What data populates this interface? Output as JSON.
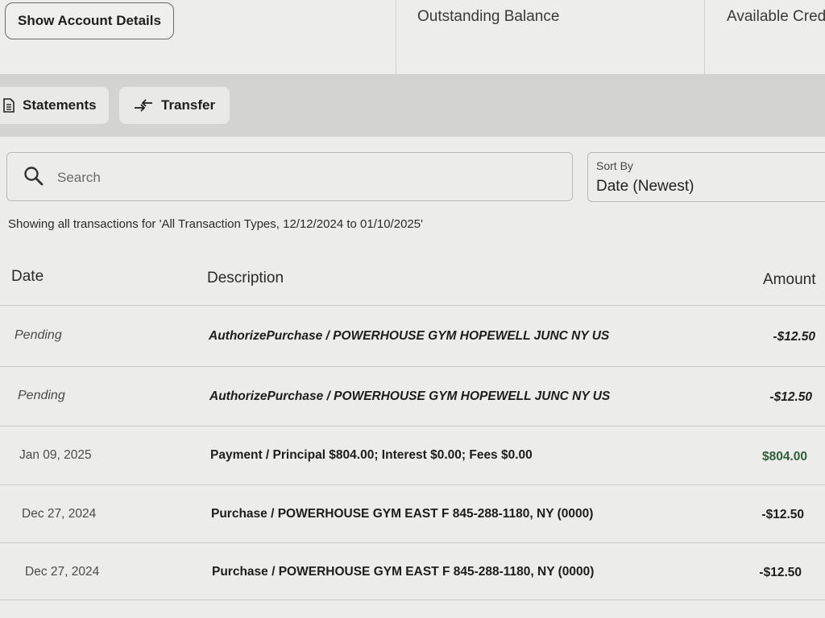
{
  "header": {
    "account_details_button": "Show Account Details",
    "outstanding_balance_label": "Outstanding Balance",
    "available_credit_label": "Available Cred"
  },
  "actions": {
    "statements_label": "Statements",
    "transfer_label": "Transfer"
  },
  "search": {
    "placeholder": "Search"
  },
  "sort": {
    "label": "Sort By",
    "value": "Date (Newest)"
  },
  "filter_summary": {
    "prefix": "Showing all transactions for ",
    "criteria": "'All Transaction Types, 12/12/2024 to 01/10/2025'"
  },
  "table": {
    "columns": {
      "date": "Date",
      "description": "Description",
      "amount": "Amount"
    },
    "rows": [
      {
        "date": "Pending",
        "description": "AuthorizePurchase / POWERHOUSE GYM HOPEWELL JUNC NY US",
        "amount": "-$12.50",
        "pending": true
      },
      {
        "date": "Pending",
        "description": "AuthorizePurchase / POWERHOUSE GYM HOPEWELL JUNC NY US",
        "amount": "-$12.50",
        "pending": true
      },
      {
        "date": "Jan 09, 2025",
        "description": "Payment / Principal $804.00; Interest $0.00; Fees $0.00",
        "amount": "$804.00",
        "credit": true
      },
      {
        "date": "Dec 27, 2024",
        "description": "Purchase / POWERHOUSE GYM EAST F 845-288-1180, NY (0000)",
        "amount": "-$12.50"
      },
      {
        "date": "Dec 27, 2024",
        "description": "Purchase / POWERHOUSE GYM EAST F 845-288-1180, NY (0000)",
        "amount": "-$12.50"
      }
    ]
  },
  "colors": {
    "credit_amount": "#2f5f3a",
    "action_band": "#d3d3d1",
    "background": "#ececea"
  }
}
